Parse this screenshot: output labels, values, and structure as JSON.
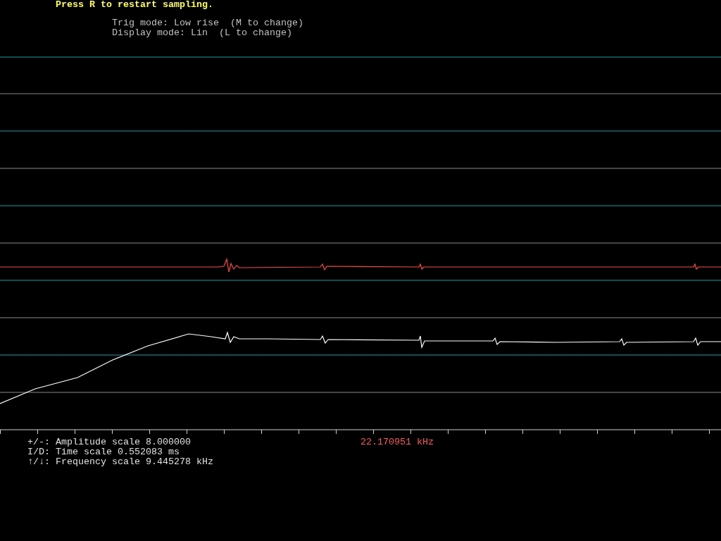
{
  "header": {
    "prompt": "Press R to restart sampling.",
    "trig_mode": "Trig mode: Low rise  (M to change)",
    "display_mode": "Display mode: Lin  (L to change)"
  },
  "status": {
    "lines": [
      "+/-: Amplitude scale 8.000000",
      "I/D: Time scale 0.552083 ms",
      "↑/↓: Frequency scale 9.445278 kHz"
    ],
    "peak_frequency": "22.170951 kHz"
  }
}
